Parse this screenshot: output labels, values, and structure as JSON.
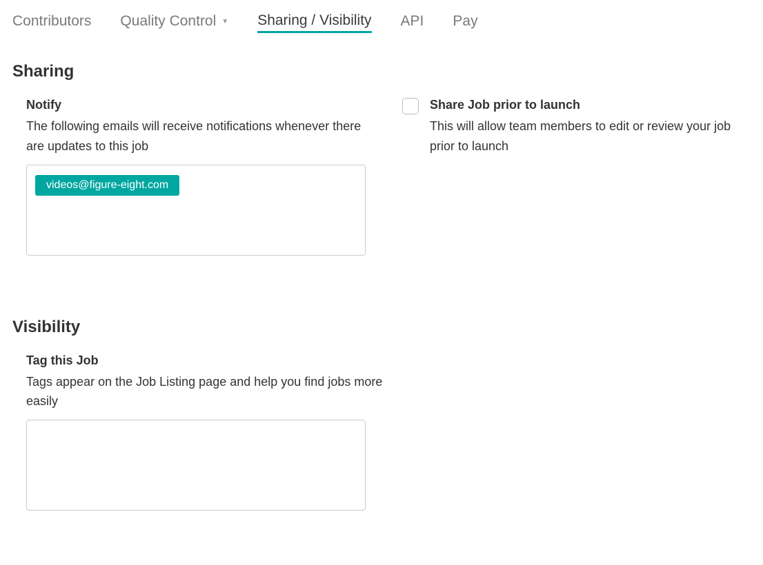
{
  "tabs": {
    "contributors": "Contributors",
    "quality_control": "Quality Control",
    "sharing_visibility": "Sharing / Visibility",
    "api": "API",
    "pay": "Pay"
  },
  "sections": {
    "sharing": "Sharing",
    "visibility": "Visibility"
  },
  "notify": {
    "title": "Notify",
    "description": "The following emails will receive notifications whenever there are updates to this job",
    "emails": [
      "videos@figure-eight.com"
    ]
  },
  "share_prior": {
    "title": "Share Job prior to launch",
    "description": "This will allow team members to edit or review your job prior to launch",
    "checked": false
  },
  "tag_job": {
    "title": "Tag this Job",
    "description": "Tags appear on the Job Listing page and help you find jobs more easily",
    "tags": []
  }
}
